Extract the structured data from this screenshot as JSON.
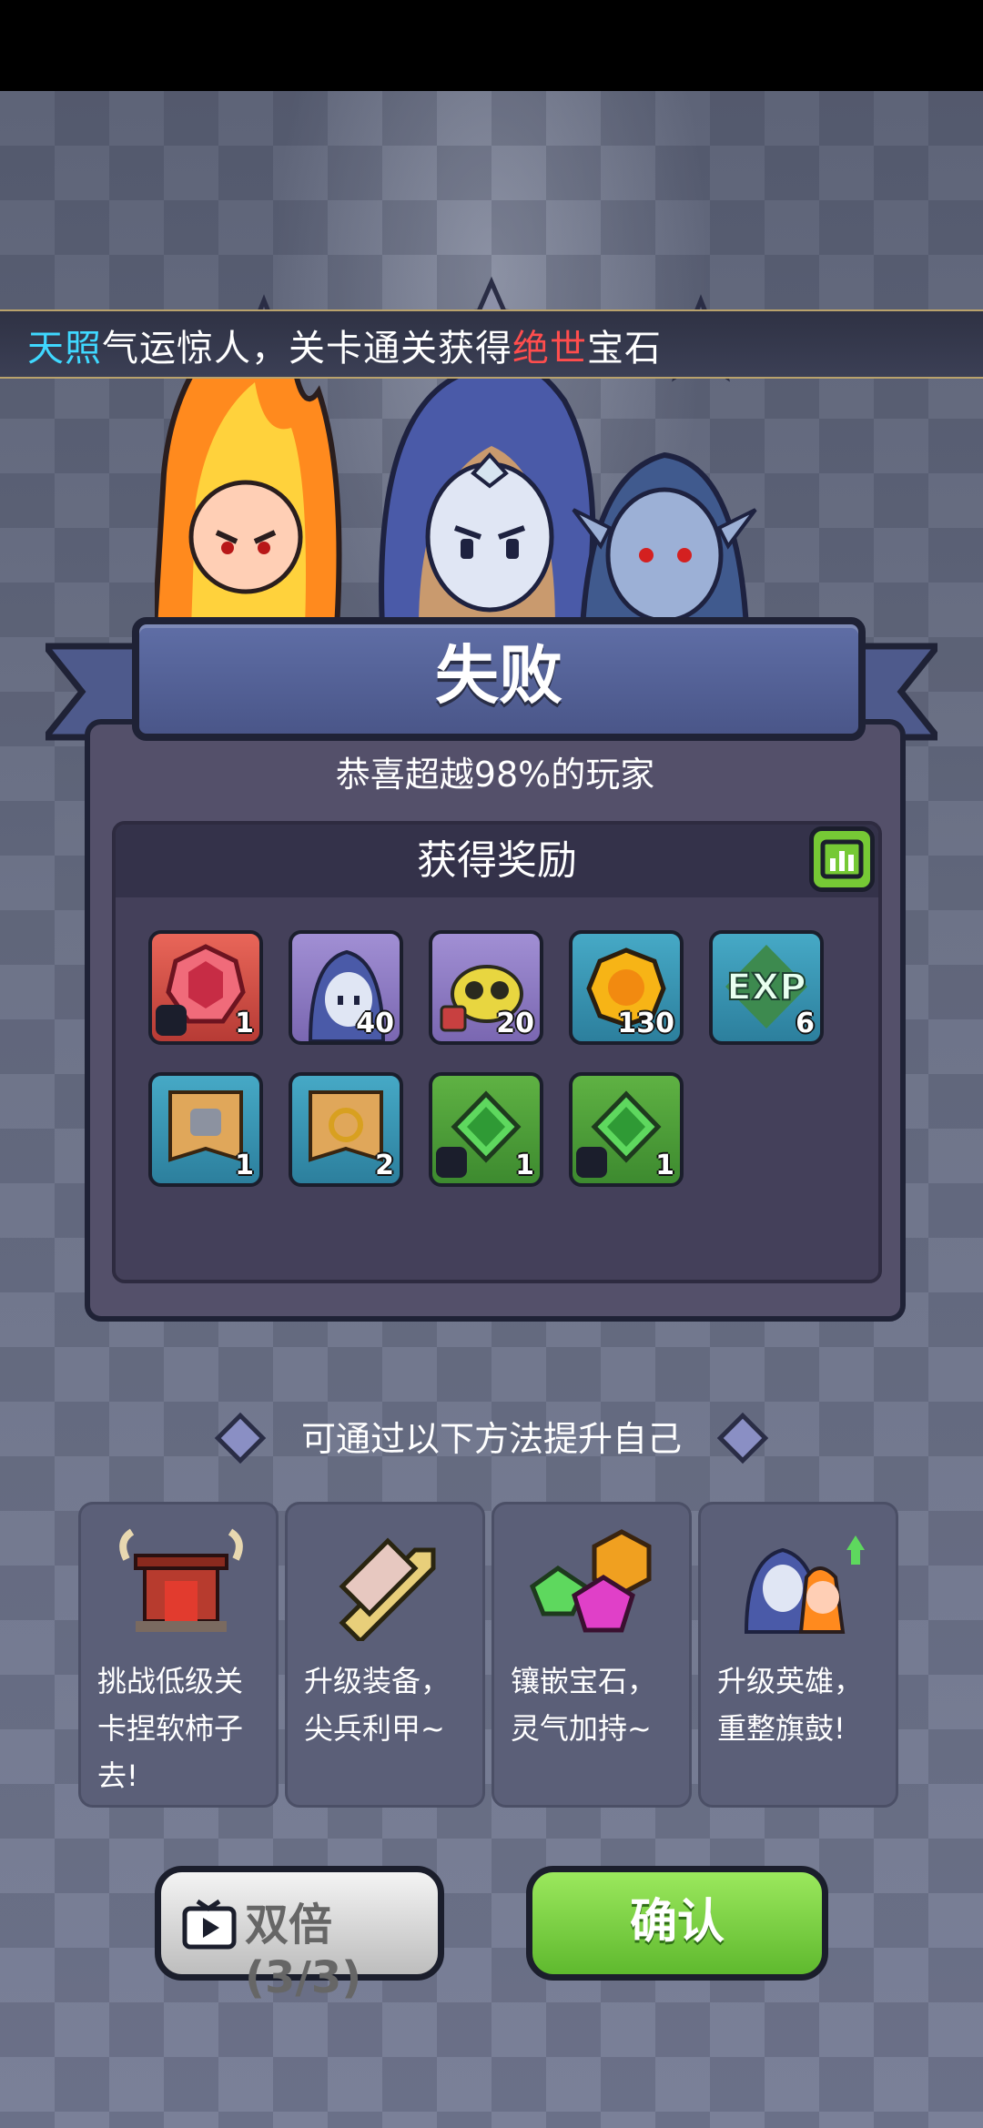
{
  "ticker": {
    "part1": "天照",
    "part2": "气运惊人，关卡通关获得",
    "part3": "绝世",
    "part4": "宝石"
  },
  "result": {
    "title": "失败",
    "subtitle": "恭喜超越98%的玩家"
  },
  "rewards": {
    "header": "获得奖励",
    "items": [
      {
        "icon": "ruby-gem-icon",
        "qty": "1"
      },
      {
        "icon": "hero-mage-icon",
        "qty": "40"
      },
      {
        "icon": "goblin-hero-icon",
        "qty": "20"
      },
      {
        "icon": "gold-coin-icon",
        "qty": "130"
      },
      {
        "icon": "exp-icon",
        "qty": "6"
      },
      {
        "icon": "armor-scroll-icon",
        "qty": "1"
      },
      {
        "icon": "ring-scroll-icon",
        "qty": "2"
      },
      {
        "icon": "green-gem-armor-icon",
        "qty": "1"
      },
      {
        "icon": "green-gem-weapon-icon",
        "qty": "1"
      }
    ]
  },
  "tips": {
    "header": "可通过以下方法提升自己",
    "cards": [
      {
        "icon": "gate-icon",
        "label": "挑战低级关卡捏软柿子去!"
      },
      {
        "icon": "equipment-icon",
        "label": "升级装备，尖兵利甲~"
      },
      {
        "icon": "gems-icon",
        "label": "镶嵌宝石，灵气加持~"
      },
      {
        "icon": "hero-upgrade-icon",
        "label": "升级英雄，重整旗鼓!"
      }
    ]
  },
  "buttons": {
    "double": "双倍(3/3)",
    "confirm": "确认"
  },
  "colors": {
    "accent_green": "#76c935",
    "ticker_cyan": "#3fd8ff",
    "ticker_red": "#ff4d4d"
  }
}
